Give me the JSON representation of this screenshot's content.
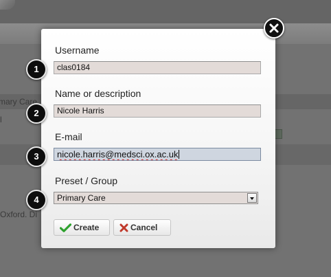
{
  "background": {
    "table_header_fragment": "mary Care",
    "row_fragment": "l",
    "footer_fragment": "Oxford. Di"
  },
  "modal": {
    "fields": [
      {
        "step": "1",
        "label": "Username",
        "value": "clas0184"
      },
      {
        "step": "2",
        "label": "Name or description",
        "value": "Nicole Harris"
      },
      {
        "step": "3",
        "label": "E-mail",
        "value": "nicole.harris@medsci.ox.ac.uk"
      },
      {
        "step": "4",
        "label": "Preset / Group",
        "value": "Primary Care"
      }
    ],
    "buttons": {
      "create_label": "Create",
      "cancel_label": "Cancel"
    }
  },
  "icons": {
    "close": "close-icon",
    "create": "checkmark-icon",
    "cancel": "x-mark-icon",
    "dropdown": "chevron-down-icon",
    "excel": "spreadsheet-icon"
  },
  "colors": {
    "create_check": "#2ea12e",
    "cancel_x": "#c0392b",
    "input_bg": "#e3dbd8",
    "focused_input_bg": "#cfd6e0"
  }
}
